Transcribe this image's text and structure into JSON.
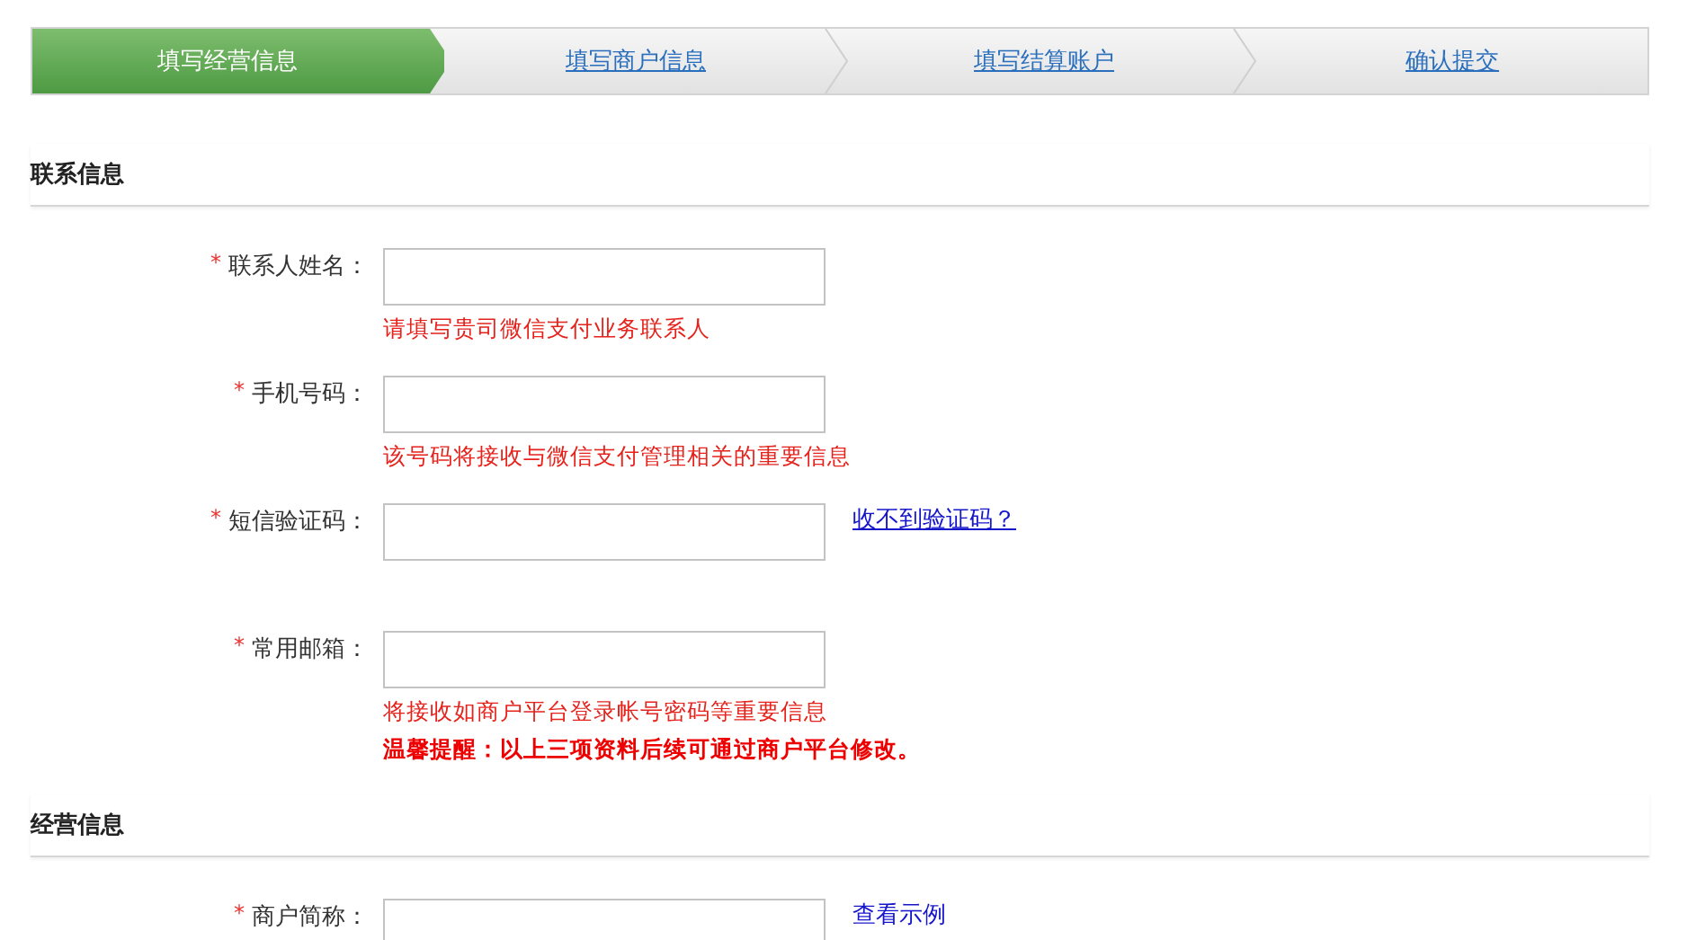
{
  "steps": [
    {
      "label": "填写经营信息",
      "selected": true
    },
    {
      "label": "填写商户信息",
      "selected": false
    },
    {
      "label": "填写结算账户",
      "selected": false
    },
    {
      "label": "确认提交",
      "selected": false
    }
  ],
  "sections": [
    {
      "title": "联系信息",
      "fields": [
        {
          "mark": "*",
          "label": "联系人姓名：",
          "notes": [
            {
              "kind": "hint",
              "text": "请填写贵司微信支付业务联系人"
            }
          ]
        },
        {
          "mark": "*",
          "label": "手机号码：",
          "notes": [
            {
              "kind": "hint",
              "text": "该号码将接收与微信支付管理相关的重要信息"
            }
          ]
        },
        {
          "mark": "*",
          "label": "短信验证码：",
          "link": "收不到验证码？",
          "underlined": true
        },
        {
          "mark": "*",
          "label": "常用邮箱：",
          "notes": [
            {
              "kind": "hint",
              "text": "将接收如商户平台登录帐号密码等重要信息"
            },
            {
              "kind": "warning",
              "text": "温馨提醒：以上三项资料后续可通过商户平台修改。"
            }
          ]
        }
      ]
    },
    {
      "title": "经营信息",
      "fields": [
        {
          "mark": "*",
          "label": "商户简称：",
          "link": "查看示例",
          "underlined": false
        }
      ]
    }
  ]
}
